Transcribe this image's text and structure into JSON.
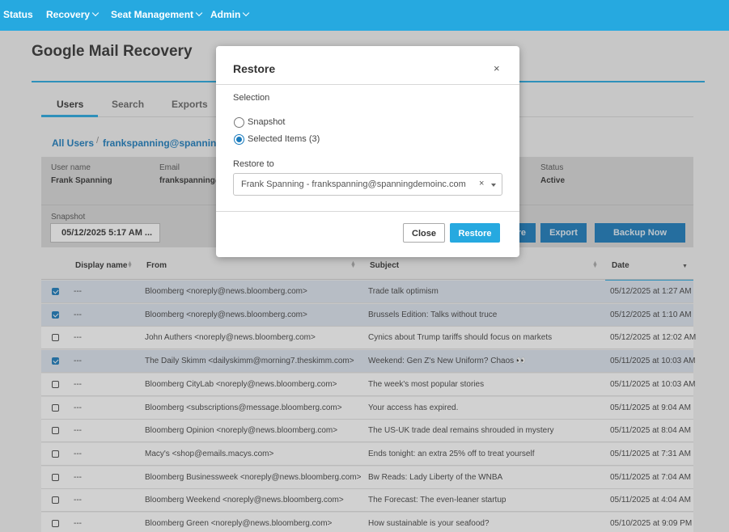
{
  "nav": {
    "status": "Status",
    "recovery": "Recovery",
    "seat_management": "Seat Management",
    "admin": "Admin"
  },
  "page": {
    "title": "Google Mail Recovery"
  },
  "tabs": [
    "Users",
    "Search",
    "Exports"
  ],
  "breadcrumb": {
    "all_users": "All Users",
    "current": "frankspanning@spanningde"
  },
  "user_info": {
    "username_label": "User name",
    "username_value": "Frank Spanning",
    "email_label": "Email",
    "email_value": "frankspanning@",
    "status_label": "Status",
    "status_value": "Active",
    "snapshot_label": "Snapshot",
    "snapshot_value": "05/12/2025 5:17 AM ..."
  },
  "actions": {
    "restore_partial": "re",
    "export": "Export",
    "backup_now": "Backup Now"
  },
  "table": {
    "headers": {
      "display_name": "Display name",
      "from": "From",
      "subject": "Subject",
      "date": "Date"
    },
    "rows": [
      {
        "checked": true,
        "display_name": "---",
        "from": "Bloomberg <noreply@news.bloomberg.com>",
        "subject": "Trade talk optimism",
        "date": "05/12/2025 at 1:27 AM"
      },
      {
        "checked": true,
        "display_name": "---",
        "from": "Bloomberg <noreply@news.bloomberg.com>",
        "subject": "Brussels Edition: Talks without truce",
        "date": "05/12/2025 at 1:10 AM"
      },
      {
        "checked": false,
        "display_name": "---",
        "from": "John Authers <noreply@news.bloomberg.com>",
        "subject": "Cynics about Trump tariffs should focus on markets",
        "date": "05/12/2025 at 12:02 AM"
      },
      {
        "checked": true,
        "display_name": "---",
        "from": "The Daily Skimm <dailyskimm@morning7.theskimm.com>",
        "subject": "Weekend: Gen Z's New Uniform? Chaos 👀",
        "date": "05/11/2025 at 10:03 AM"
      },
      {
        "checked": false,
        "display_name": "---",
        "from": "Bloomberg CityLab <noreply@news.bloomberg.com>",
        "subject": "The week's most popular stories",
        "date": "05/11/2025 at 10:03 AM"
      },
      {
        "checked": false,
        "display_name": "---",
        "from": "Bloomberg <subscriptions@message.bloomberg.com>",
        "subject": "Your access has expired.",
        "date": "05/11/2025 at 9:04 AM"
      },
      {
        "checked": false,
        "display_name": "---",
        "from": "Bloomberg Opinion <noreply@news.bloomberg.com>",
        "subject": "The US-UK trade deal remains shrouded in mystery",
        "date": "05/11/2025 at 8:04 AM"
      },
      {
        "checked": false,
        "display_name": "---",
        "from": "Macy's <shop@emails.macys.com>",
        "subject": "Ends tonight: an extra 25% off to treat yourself",
        "date": "05/11/2025 at 7:31 AM"
      },
      {
        "checked": false,
        "display_name": "---",
        "from": "Bloomberg Businessweek <noreply@news.bloomberg.com>",
        "subject": "Bw Reads: Lady Liberty of the WNBA",
        "date": "05/11/2025 at 7:04 AM"
      },
      {
        "checked": false,
        "display_name": "---",
        "from": "Bloomberg Weekend <noreply@news.bloomberg.com>",
        "subject": "The Forecast: The even-leaner startup",
        "date": "05/11/2025 at 4:04 AM"
      },
      {
        "checked": false,
        "display_name": "---",
        "from": "Bloomberg Green <noreply@news.bloomberg.com>",
        "subject": "How sustainable is your seafood?",
        "date": "05/10/2025 at 9:09 PM"
      }
    ]
  },
  "modal": {
    "title": "Restore",
    "close_glyph": "×",
    "selection_label": "Selection",
    "option_snapshot": "Snapshot",
    "option_selected": "Selected Items (3)",
    "selected_option": "selected_items",
    "restore_to_label": "Restore to",
    "restore_to_value": "Frank Spanning - frankspanning@spanningdemoinc.com",
    "clear_glyph": "×",
    "close_button": "Close",
    "restore_button": "Restore"
  },
  "colors": {
    "nav_bg": "#26a9e0",
    "primary": "#1a7bbd",
    "selected_row": "#dde4ef"
  }
}
